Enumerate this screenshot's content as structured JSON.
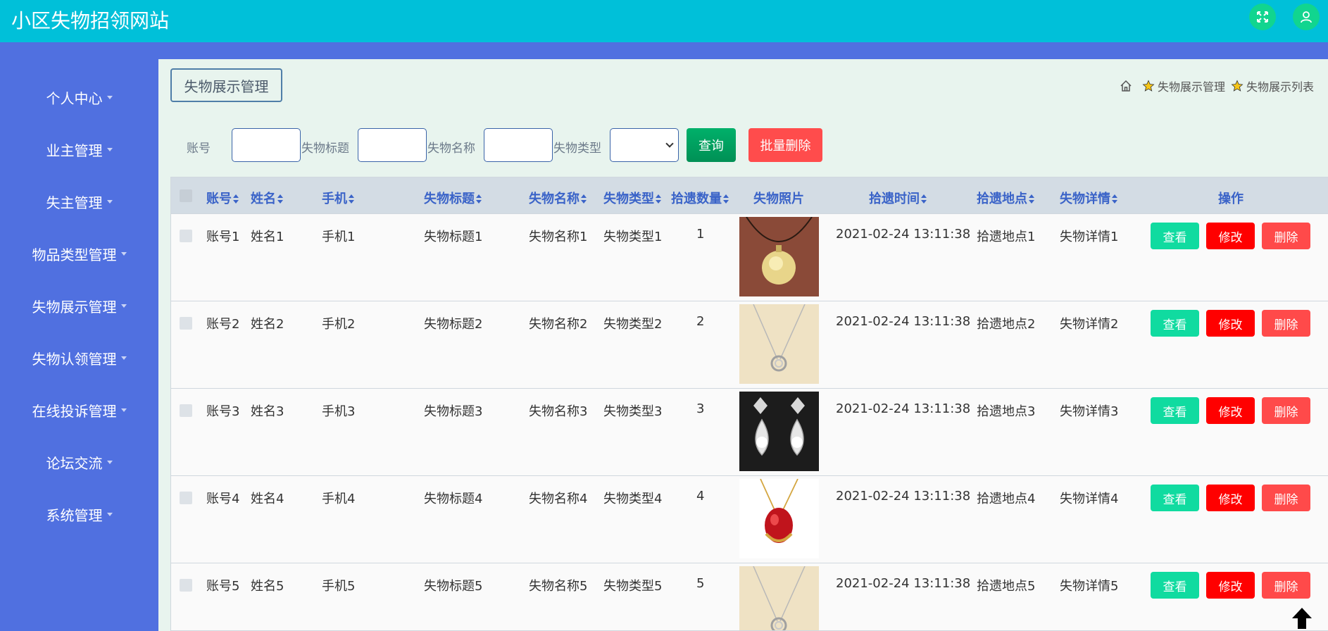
{
  "header": {
    "title": "小区失物招领网站"
  },
  "sidebar": {
    "items": [
      {
        "label": "个人中心"
      },
      {
        "label": "业主管理"
      },
      {
        "label": "失主管理"
      },
      {
        "label": "物品类型管理"
      },
      {
        "label": "失物展示管理"
      },
      {
        "label": "失物认领管理"
      },
      {
        "label": "在线投诉管理"
      },
      {
        "label": "论坛交流"
      },
      {
        "label": "系统管理"
      }
    ]
  },
  "page": {
    "title": "失物展示管理"
  },
  "breadcrumb": {
    "level1": "失物展示管理",
    "level2": "失物展示列表"
  },
  "search": {
    "label_account": "账号",
    "label_title": "失物标题",
    "label_name": "失物名称",
    "label_type": "失物类型",
    "query_button": "查询",
    "batch_delete_button": "批量删除"
  },
  "table": {
    "headers": {
      "account": "账号",
      "name": "姓名",
      "phone": "手机",
      "title": "失物标题",
      "item_name": "失物名称",
      "item_type": "失物类型",
      "quantity": "拾遗数量",
      "photo": "失物照片",
      "time": "拾遗时间",
      "place": "拾遗地点",
      "detail": "失物详情",
      "actions": "操作"
    },
    "actions": {
      "view": "查看",
      "edit": "修改",
      "delete": "删除"
    },
    "rows": [
      {
        "account": "账号1",
        "name": "姓名1",
        "phone": "手机1",
        "title": "失物标题1",
        "item_name": "失物名称1",
        "item_type": "失物类型1",
        "quantity": "1",
        "time": "2021-02-24 13:11:38",
        "place": "拾遗地点1",
        "detail": "失物详情1"
      },
      {
        "account": "账号2",
        "name": "姓名2",
        "phone": "手机2",
        "title": "失物标题2",
        "item_name": "失物名称2",
        "item_type": "失物类型2",
        "quantity": "2",
        "time": "2021-02-24 13:11:38",
        "place": "拾遗地点2",
        "detail": "失物详情2"
      },
      {
        "account": "账号3",
        "name": "姓名3",
        "phone": "手机3",
        "title": "失物标题3",
        "item_name": "失物名称3",
        "item_type": "失物类型3",
        "quantity": "3",
        "time": "2021-02-24 13:11:38",
        "place": "拾遗地点3",
        "detail": "失物详情3"
      },
      {
        "account": "账号4",
        "name": "姓名4",
        "phone": "手机4",
        "title": "失物标题4",
        "item_name": "失物名称4",
        "item_type": "失物类型4",
        "quantity": "4",
        "time": "2021-02-24 13:11:38",
        "place": "拾遗地点4",
        "detail": "失物详情4"
      },
      {
        "account": "账号5",
        "name": "姓名5",
        "phone": "手机5",
        "title": "失物标题5",
        "item_name": "失物名称5",
        "item_type": "失物类型5",
        "quantity": "5",
        "time": "2021-02-24 13:11:38",
        "place": "拾遗地点5",
        "detail": "失物详情5"
      }
    ]
  },
  "colors": {
    "header_bg": "#00c0d9",
    "sidebar_bg": "#5070e0",
    "content_bg": "#e8f4ee",
    "view_btn": "#10dba0",
    "edit_btn": "#ff0000",
    "delete_btn": "#ff4a4a"
  }
}
